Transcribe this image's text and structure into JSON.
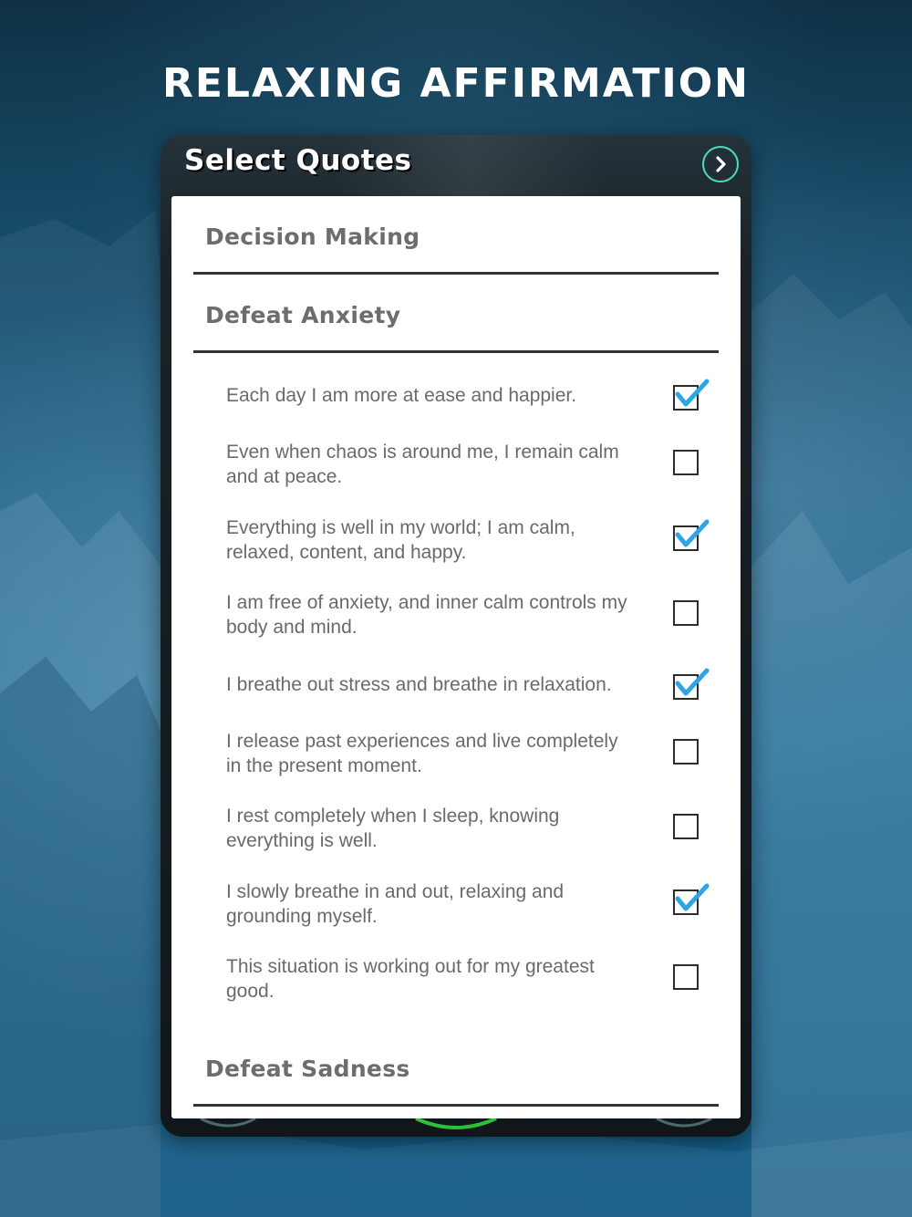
{
  "header": {
    "title": "RELAXING AFFIRMATION"
  },
  "card": {
    "title": "Select Quotes",
    "next_icon": "chevron-right-icon",
    "accent_color": "#49e0b7",
    "check_color": "#2ea6e6"
  },
  "categories": [
    {
      "label": "Decision Making"
    },
    {
      "label": "Defeat Anxiety"
    },
    {
      "label": "Defeat Sadness"
    }
  ],
  "quotes": [
    {
      "text": "Each day I am more at ease and happier.",
      "checked": true
    },
    {
      "text": "Even when chaos is around me, I remain calm and at peace.",
      "checked": false
    },
    {
      "text": "Everything is well in my world; I am calm, relaxed, content, and happy.",
      "checked": true
    },
    {
      "text": "I am free of anxiety, and inner calm controls my body and mind.",
      "checked": false
    },
    {
      "text": "I breathe out stress and breathe in relaxation.",
      "checked": true
    },
    {
      "text": "I release past experiences and live completely in the present moment.",
      "checked": false
    },
    {
      "text": "I rest completely when I sleep, knowing everything is well.",
      "checked": false
    },
    {
      "text": "I slowly breathe in and out, relaxing and grounding myself.",
      "checked": true
    },
    {
      "text": "This situation is working out for my greatest good.",
      "checked": false
    }
  ]
}
